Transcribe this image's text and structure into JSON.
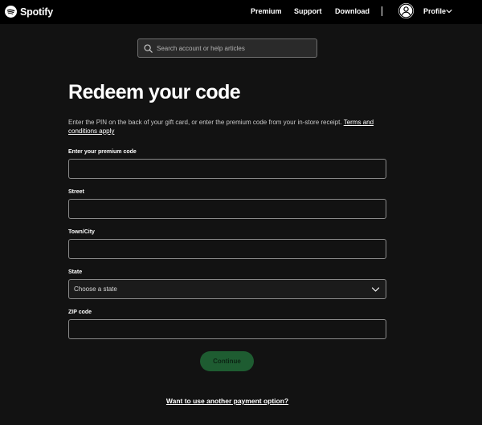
{
  "header": {
    "logo_text": "Spotify",
    "nav": {
      "premium": "Premium",
      "support": "Support",
      "download": "Download"
    },
    "profile_label": "Profile"
  },
  "search": {
    "placeholder": "Search account or help articles"
  },
  "main": {
    "title": "Redeem your code",
    "intro_text": "Enter the PIN on the back of your gift card, or enter the premium code from your in-store receipt. ",
    "terms_link": "Terms and conditions apply",
    "fields": {
      "code_label": "Enter your premium code",
      "street_label": "Street",
      "town_label": "Town/City",
      "state_label": "State",
      "state_value": "Choose a state",
      "zip_label": "ZIP code"
    },
    "continue_label": "Continue",
    "other_payment_link": "Want to use another payment option?"
  },
  "colors": {
    "background": "#121212",
    "header": "#000000",
    "accent_green": "#1e5c31"
  }
}
